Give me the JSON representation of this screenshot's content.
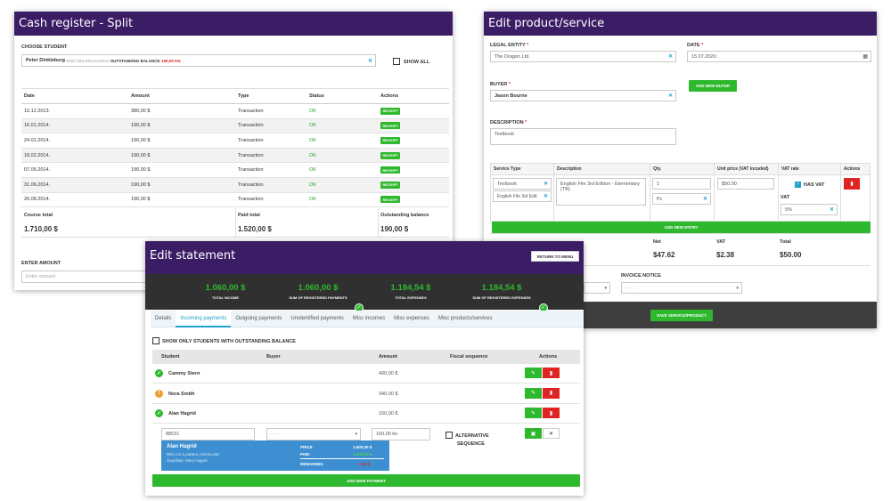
{
  "cash": {
    "title": "Cash register - Split",
    "choose_label": "CHOOSE STUDENT",
    "student_name": "Peter Dinkleburg",
    "student_meta": "ENG,CB2,Dina Kozlova",
    "outstanding_label": "OUTSTANDING BALANCE",
    "outstanding_value": "190,00 KN",
    "show_all": "SHOW ALL",
    "columns": [
      "Date",
      "Amount",
      "Type",
      "Status",
      "Actions"
    ],
    "rows": [
      {
        "date": "10.12.2013.",
        "amount": "380,00 $",
        "type": "Transaction",
        "status": "OK",
        "action": "RECEIPT"
      },
      {
        "date": "16.01.2014.",
        "amount": "190,00 $",
        "type": "Transaction",
        "status": "OK",
        "action": "RECEIPT"
      },
      {
        "date": "24.01.2014.",
        "amount": "190,00 $",
        "type": "Transaction",
        "status": "OK",
        "action": "RECEIPT"
      },
      {
        "date": "18.02.2014.",
        "amount": "190,00 $",
        "type": "Transaction",
        "status": "OK",
        "action": "RECEIPT"
      },
      {
        "date": "07.05.2014.",
        "amount": "190,00 $",
        "type": "Transaction",
        "status": "OK",
        "action": "RECEIPT"
      },
      {
        "date": "31.06.2014.",
        "amount": "190,00 $",
        "type": "Transaction",
        "status": "OK",
        "action": "RECEIPT"
      },
      {
        "date": "26.08.2014.",
        "amount": "190,00 $",
        "type": "Transaction",
        "status": "OK",
        "action": "RECEIPT"
      }
    ],
    "course_total_label": "Course total",
    "course_total": "1.710,00 $",
    "paid_total_label": "Paid total",
    "paid_total": "1.520,00 $",
    "outstanding_balance_label": "Outstanding balance",
    "outstanding_balance": "190,00 $",
    "enter_amount_label": "ENTER AMOUNT",
    "enter_amount_placeholder": "Enter amount"
  },
  "product": {
    "title": "Edit product/service",
    "legal_entity_label": "LEGAL ENTITY",
    "legal_entity_value": "The Dragon Ltd.",
    "date_label": "DATE",
    "date_value": "15.07.2020.",
    "buyer_label": "BUYER",
    "buyer_value": "Jason Bourne",
    "add_buyer": "ADD NEW BUYER",
    "description_label": "DESCRIPTION",
    "description_value": "Textbook",
    "columns": [
      "Service Type",
      "Description",
      "Qty.",
      "Unit price (VAT incuded)",
      "VAT rate",
      "Actions"
    ],
    "service_type": "Textbook",
    "service_sub": "English File 3rd Edit",
    "item_description": "English File 3rd Edition - Elementary (TB)",
    "qty": "1",
    "unit": "Pc",
    "unit_price": "$50.00",
    "has_vat": "HAS VAT",
    "vat_label": "VAT",
    "vat_value": "5%",
    "add_entry": "ADD NEW ENTRY",
    "net_label": "Net",
    "net_value": "$47.62",
    "vat_total_label": "VAT",
    "vat_total_value": "$2.38",
    "total_label": "Total",
    "total_value": "$50.00",
    "invoice_notice_label": "INVOICE NOTICE",
    "select_placeholder": "- - -",
    "save": "SAVE SERVICE/PRODUCT"
  },
  "statement": {
    "title": "Edit statement",
    "return": "RETURN TO MENU",
    "stats": [
      {
        "value": "1.060,00 $",
        "label": "TOTAL INCOME"
      },
      {
        "value": "1.060,00 $",
        "label": "SUM OF REGISTERED PAYMENTS"
      },
      {
        "value": "1.184,54 $",
        "label": "TOTAL EXPENSES"
      },
      {
        "value": "1.184,54 $",
        "label": "SUM OF REGISTERED EXPENSES"
      }
    ],
    "tabs": [
      "Details",
      "Incoming payments",
      "Outgoing payments",
      "Unidentified payments",
      "Misc incomes",
      "Misc expenses",
      "Misc products/services"
    ],
    "show_only": "SHOW ONLY STUDENTS WITH OUTSTANDING BALANCE",
    "columns": [
      "Student",
      "Buyer",
      "Amount",
      "Fiscal sequence",
      "Actions"
    ],
    "rows": [
      {
        "name": "Cammy Stern",
        "amount": "400,00 $",
        "status": "ok"
      },
      {
        "name": "Nora Smith",
        "amount": "340,00 $",
        "status": "partial"
      },
      {
        "name": "Alan Hagrid",
        "amount": "160,00 $",
        "status": "ok"
      }
    ],
    "edit_student": "88531",
    "edit_buyer": "- - -",
    "edit_amount": "160,00 kn",
    "alternative": "ALTERNATIVE",
    "sequence": "SEQUENCE",
    "popup_name": "Alan Hagrid",
    "popup_meta1": "DEU,A1.1,pattaro,Ambria,Sat",
    "popup_meta2": "Guardian: Mary Hagrid",
    "price_label": "PRICE",
    "price_value": "1.600,00 $",
    "paid_label": "PAID",
    "paid_value": "1.600,00 $",
    "remaining_label": "REMAINING",
    "remaining_value": "0,00 $",
    "add_payment": "ADD NEW PAYMENT",
    "colors": {
      "accent": "#3b1d66",
      "green": "#2eb82e",
      "red": "#e02424",
      "blue": "#3d8fd1"
    }
  }
}
